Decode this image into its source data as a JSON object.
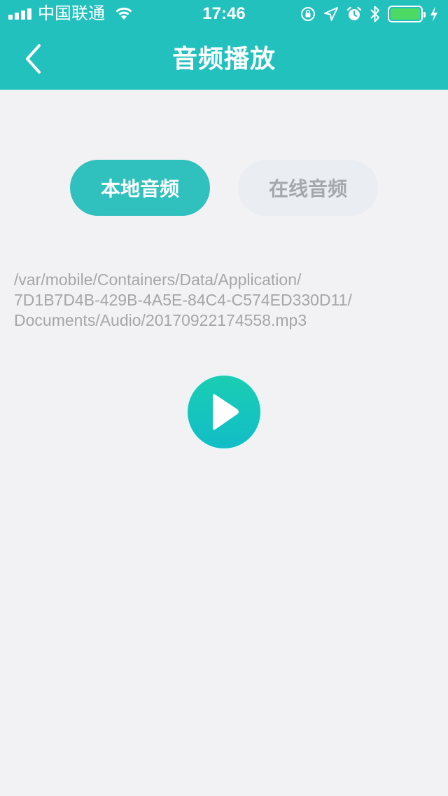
{
  "status_bar": {
    "carrier": "中国联通",
    "time": "17:46",
    "battery_level": 1.0,
    "icons": [
      "signal-icon",
      "wifi-icon",
      "rotation-lock-icon",
      "location-icon",
      "alarm-icon",
      "bluetooth-icon",
      "battery-icon",
      "charging-icon"
    ]
  },
  "nav": {
    "title": "音频播放",
    "back_icon": "chevron-left-icon"
  },
  "tabs": [
    {
      "label": "本地音频",
      "selected": true
    },
    {
      "label": "在线音频",
      "selected": false
    }
  ],
  "file_path": {
    "line1": "/var/mobile/Containers/Data/Application/",
    "line2": "7D1B7D4B-429B-4A5E-84C4-C574ED330D11/",
    "line3": "Documents/Audio/20170922174558.mp3"
  },
  "player": {
    "icon": "play-icon"
  },
  "colors": {
    "header_bg": "#22c1be",
    "tab_active_bg": "#30c0bd",
    "tab_inactive_bg": "#eaeef2",
    "tab_inactive_text": "#a4a7ab",
    "path_text": "#a6a6a9",
    "page_bg": "#f2f2f4"
  }
}
